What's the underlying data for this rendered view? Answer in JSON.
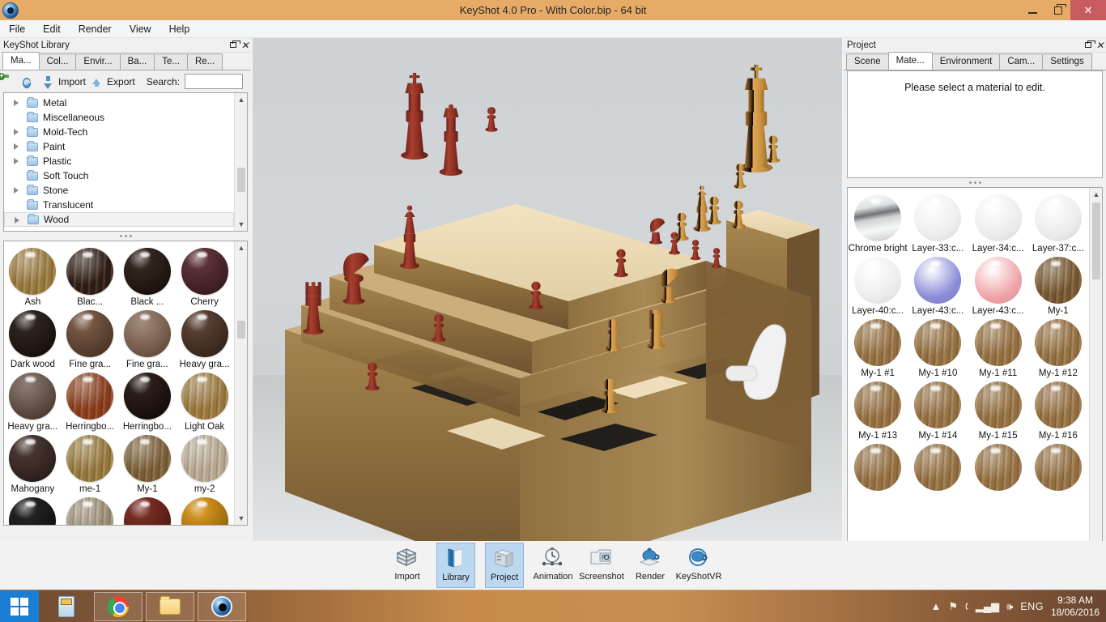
{
  "window": {
    "title": "KeyShot 4.0 Pro  - With Color.bip  - 64 bit",
    "app_icon": "keyshot-app-icon",
    "minimize_label": "Minimize",
    "maximize_label": "Restore",
    "close_label": "Close",
    "titlebar_color": "#e7ab68",
    "close_color": "#c75b60"
  },
  "menubar": {
    "items": [
      {
        "label": "File"
      },
      {
        "label": "Edit"
      },
      {
        "label": "Render"
      },
      {
        "label": "View"
      },
      {
        "label": "Help"
      }
    ]
  },
  "library_panel": {
    "caption": "KeyShot Library",
    "restore_label": "Restore panel",
    "close_label": "Close panel",
    "tabs": [
      {
        "label": "Ma...",
        "active": true
      },
      {
        "label": "Col...",
        "active": false
      },
      {
        "label": "Envir...",
        "active": false
      },
      {
        "label": "Ba...",
        "active": false
      },
      {
        "label": "Te...",
        "active": false
      },
      {
        "label": "Re...",
        "active": false
      }
    ],
    "toolbar": {
      "new_folder_icon": "new-folder-icon",
      "refresh_icon": "refresh-icon",
      "import_label": "Import",
      "export_label": "Export",
      "search_label": "Search:",
      "search_value": "",
      "search_placeholder": ""
    },
    "tree": [
      {
        "label": "Metal",
        "expandable": true,
        "selected": false
      },
      {
        "label": "Miscellaneous",
        "expandable": false,
        "selected": false
      },
      {
        "label": "Mold-Tech",
        "expandable": true,
        "selected": false
      },
      {
        "label": "Paint",
        "expandable": true,
        "selected": false
      },
      {
        "label": "Plastic",
        "expandable": true,
        "selected": false
      },
      {
        "label": "Soft Touch",
        "expandable": false,
        "selected": false
      },
      {
        "label": "Stone",
        "expandable": true,
        "selected": false
      },
      {
        "label": "Translucent",
        "expandable": false,
        "selected": false
      },
      {
        "label": "Wood",
        "expandable": true,
        "selected": true
      }
    ],
    "materials": [
      {
        "name": "Ash",
        "color": "#9d7c3e",
        "style": "wood-light"
      },
      {
        "name": "Blac...",
        "color": "#2e1d13",
        "style": "wood-dark"
      },
      {
        "name": "Black ...",
        "color": "#241710",
        "style": "gloss-dark"
      },
      {
        "name": "Cherry",
        "color": "#50242c",
        "style": "gloss"
      },
      {
        "name": "Dark wood",
        "color": "#201510",
        "style": "gloss-dark"
      },
      {
        "name": "Fine gra...",
        "color": "#6b4a36",
        "style": "gloss"
      },
      {
        "name": "Fine gra...",
        "color": "#7d5b45",
        "style": "matte"
      },
      {
        "name": "Heavy gra...",
        "color": "#4b3225",
        "style": "gloss"
      },
      {
        "name": "Heavy gra...",
        "color": "#5c4538",
        "style": "matte"
      },
      {
        "name": "Herringbo...",
        "color": "#8d3f1c",
        "style": "wood-red"
      },
      {
        "name": "Herringbo...",
        "color": "#1e0f0b",
        "style": "gloss-dark"
      },
      {
        "name": "Light Oak",
        "color": "#a07c41",
        "style": "wood-light"
      },
      {
        "name": "Mahogany",
        "color": "#3b2822",
        "style": "gloss-dark"
      },
      {
        "name": "me-1",
        "color": "#9a7c3f",
        "style": "wood-light"
      },
      {
        "name": "My-1",
        "color": "#7e6138",
        "style": "wood-med"
      },
      {
        "name": "my-2",
        "color": "#bdae96",
        "style": "wood-pale"
      },
      {
        "name": "",
        "color": "#141414",
        "style": "gloss-dark"
      },
      {
        "name": "",
        "color": "#a09178",
        "style": "wood-pale"
      },
      {
        "name": "",
        "color": "#6d1f16",
        "style": "gloss"
      },
      {
        "name": "",
        "color": "#c8860e",
        "style": "gloss"
      }
    ]
  },
  "viewport": {
    "name": "render-viewport",
    "scene_description": "3D rendered stepped chessboard with wooden blocks and red and orange chess pieces",
    "background_color": "#d0d3d5"
  },
  "project_panel": {
    "caption": "Project",
    "restore_label": "Restore panel",
    "close_label": "Close panel",
    "tabs": [
      {
        "label": "Scene",
        "active": false
      },
      {
        "label": "Mate...",
        "active": true
      },
      {
        "label": "Environment",
        "active": false
      },
      {
        "label": "Cam...",
        "active": false
      },
      {
        "label": "Settings",
        "active": false
      }
    ],
    "empty_message": "Please select a material to edit.",
    "materials": [
      {
        "name": "Chrome bright",
        "color": "#c9cbcc",
        "style": "chrome"
      },
      {
        "name": "Layer-33:c...",
        "color": "#ededed",
        "style": "plain"
      },
      {
        "name": "Layer-34:c...",
        "color": "#ececec",
        "style": "plain"
      },
      {
        "name": "Layer-37:c...",
        "color": "#ebebeb",
        "style": "plain"
      },
      {
        "name": "Layer-40:c...",
        "color": "#ececec",
        "style": "plain"
      },
      {
        "name": "Layer-43:c...",
        "color": "#8b8cd8",
        "style": "plain"
      },
      {
        "name": "Layer-43:c...",
        "color": "#efa3a8",
        "style": "plain"
      },
      {
        "name": "My-1",
        "color": "#7a5b33",
        "style": "wood"
      },
      {
        "name": "My-1 #1",
        "color": "#9a7444",
        "style": "wood"
      },
      {
        "name": "My-1 #10",
        "color": "#9a7444",
        "style": "wood"
      },
      {
        "name": "My-1 #11",
        "color": "#9a7444",
        "style": "wood"
      },
      {
        "name": "My-1 #12",
        "color": "#9a7444",
        "style": "wood"
      },
      {
        "name": "My-1 #13",
        "color": "#9a7444",
        "style": "wood"
      },
      {
        "name": "My-1 #14",
        "color": "#9a7444",
        "style": "wood"
      },
      {
        "name": "My-1 #15",
        "color": "#9a7444",
        "style": "wood"
      },
      {
        "name": "My-1 #16",
        "color": "#9a7444",
        "style": "wood"
      },
      {
        "name": "",
        "color": "#9a7444",
        "style": "wood"
      },
      {
        "name": "",
        "color": "#9a7444",
        "style": "wood"
      },
      {
        "name": "",
        "color": "#9a7444",
        "style": "wood"
      },
      {
        "name": "",
        "color": "#9a7444",
        "style": "wood"
      }
    ]
  },
  "bottom_toolbar": {
    "items": [
      {
        "label": "Import",
        "icon": "import-icon",
        "active": false
      },
      {
        "label": "Library",
        "icon": "library-icon",
        "active": true
      },
      {
        "label": "Project",
        "icon": "project-icon",
        "active": true
      },
      {
        "label": "Animation",
        "icon": "animation-icon",
        "active": false
      },
      {
        "label": "Screenshot",
        "icon": "screenshot-icon",
        "active": false
      },
      {
        "label": "Render",
        "icon": "render-icon",
        "active": false
      },
      {
        "label": "KeyShotVR",
        "icon": "keyshotvr-icon",
        "active": false
      }
    ]
  },
  "taskbar": {
    "start_label": "Start",
    "tasks": [
      {
        "name": "calculator-task",
        "icon": "calculator-icon",
        "pinned": false
      },
      {
        "name": "chrome-task",
        "icon": "chrome-icon",
        "pinned": true
      },
      {
        "name": "file-explorer-task",
        "icon": "folder-icon",
        "pinned": true
      },
      {
        "name": "keyshot-task",
        "icon": "keyshot-icon",
        "pinned": true
      }
    ],
    "tray": {
      "show_hidden_label": "▲",
      "action_center_icon": "flag-icon",
      "network_icon": "network-icon",
      "signal_icon": "signal-bars-icon",
      "volume_icon": "volume-icon",
      "language": "ENG",
      "time": "9:38 AM",
      "date": "18/06/2016"
    }
  }
}
